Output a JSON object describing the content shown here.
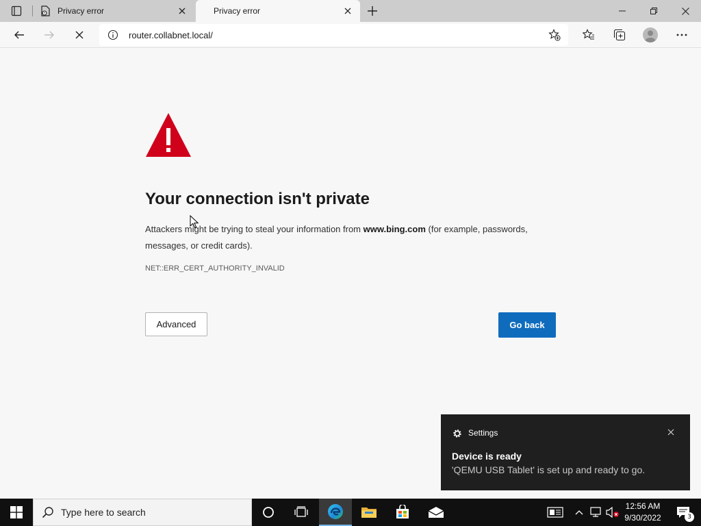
{
  "browser": {
    "tabs": [
      {
        "title": "Privacy error",
        "active": false
      },
      {
        "title": "Privacy error",
        "active": true
      }
    ],
    "address": {
      "url": "router.collabnet.local/"
    }
  },
  "page": {
    "headline": "Your connection isn't private",
    "desc_before": "Attackers might be trying to steal your information from ",
    "desc_site": "www.bing.com",
    "desc_after": " (for example, passwords, messages, or credit cards).",
    "error_code": "NET::ERR_CERT_AUTHORITY_INVALID",
    "advanced_label": "Advanced",
    "go_back_label": "Go back"
  },
  "toast": {
    "app": "Settings",
    "title": "Device is ready",
    "body": "'QEMU USB Tablet' is set up and ready to go."
  },
  "taskbar": {
    "search_placeholder": "Type here to search",
    "time": "12:56 AM",
    "date": "9/30/2022",
    "notification_count": "3"
  },
  "colors": {
    "accent": "#0f6cbd",
    "warning_red": "#d0021b",
    "toast_bg": "#1f1f1f"
  }
}
